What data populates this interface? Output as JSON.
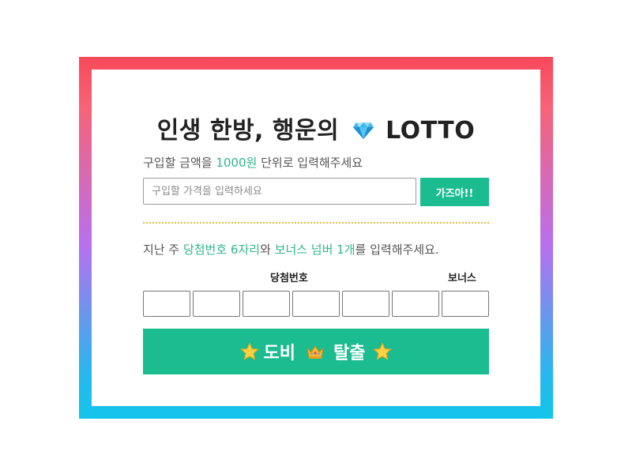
{
  "title": {
    "text": "인생 한방, 행운의",
    "icon": "diamond-icon",
    "brand": "LOTTO"
  },
  "purchase": {
    "instruction_pre": "구입할 금액을 ",
    "instruction_highlight": "1000원",
    "instruction_post": " 단위로 입력해주세요",
    "input_placeholder": "구입할 가격을 입력하세요",
    "input_value": "",
    "button_label": "가즈아!!"
  },
  "winning": {
    "instruction_pre": "지난 주 ",
    "instruction_highlight1": "당첨번호 6자리",
    "instruction_mid": "와 ",
    "instruction_highlight2": "보너스 넘버 1개",
    "instruction_post": "를 입력해주세요.",
    "winning_label": "당첨번호",
    "bonus_label": "보너스",
    "numbers": [
      "",
      "",
      "",
      "",
      "",
      ""
    ],
    "bonus": ""
  },
  "escape_button": {
    "word1": "도비",
    "word2": "탈출",
    "icons": [
      "star-icon",
      "crown-icon",
      "star-icon"
    ]
  },
  "colors": {
    "accent": "#1bbc8f",
    "highlight_text": "#2fb590",
    "divider": "#e5b93b",
    "gradient_top": "#f7495a",
    "gradient_mid": "#b870ee",
    "gradient_bottom": "#12c6ea"
  }
}
